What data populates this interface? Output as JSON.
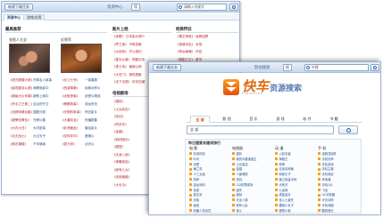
{
  "back_window": {
    "dropdown": "新建下载任务",
    "title": "资源中心",
    "search_placeholder": "请输入关键字",
    "search_button": "搜",
    "tabs": [
      "资源中心",
      "游戏/应用"
    ],
    "sections": {
      "hot_movies": "最具推荐",
      "new_releases": "新片上档",
      "classics": "经典怀旧"
    },
    "movie_one": "张智人大全",
    "movie_two": "近视军",
    "list_left": [
      "《阳光照耀大家》",
      "《影视部战斗团》",
      "《超级大片来袭》",
      "《杀手之王第二》",
      "《战狼特辑合集》",
      "《超警告警告》",
      "《大内小白》",
      "《功夫战士》",
      "《鲜花满楼》"
    ],
    "list_left2": [
      "开原名人故事",
      "我看电影中",
      "新鲜上映中",
      "百合的守卫",
      "国剧分类",
      "光荣片集",
      "大内密探",
      "大汉天子",
      "千年情缘"
    ],
    "list_mid": [
      "《长江七号》",
      "《西游降魔》",
      "《太极侠客》",
      "《警察故事》",
      "《光阴的故事》",
      "《大唐双龙》",
      "《卧虎藏龙》",
      "《花样年华》",
      "《霍元甲》"
    ],
    "list_mid2": [
      "一部喜剧",
      "经典动作片",
      "武侠片精选",
      "成龙系列",
      "怀旧影片",
      "热播剧集",
      "最佳影片",
      "爱情片",
      "功夫片"
    ],
    "new_list": [
      "《赤壁》 日本影片简介",
      "《梦之旅》 不再发散",
      "《大侦探》 开心相约",
      "《星光大道》 明星访谈",
      "《勇士传》 最新公映",
      "《大宅门》 精彩剧集",
      "《天下无贼》 好评如潮"
    ],
    "classic_list": [
      "《霸王别姬》 经典回顾",
      "《英雄本色》 永恒",
      "《倩女幽魂》 怀旧",
      "《喜剧之王》 星爷",
      "《射雕英雄传》 重温",
      "《西游记》 童年回忆",
      "《水浒传》 名著"
    ],
    "subsection": "电视剧场",
    "tv_list": [
      "《潜伏》",
      "《士兵突击》",
      "《亮剑》",
      "《闯关东》",
      "《金婚》",
      "《我的团长》",
      "《蜗居》",
      "《天龙八部》",
      "《神雕侠侣》",
      "《家有儿女》",
      "《还珠格格》",
      "《大长今》"
    ]
  },
  "front_window": {
    "dropdown": "新建下载任务",
    "title": "影视搜索",
    "search_value": "外搜",
    "search_button": "搜",
    "logo_text": "快车",
    "logo_sub_text": "资源搜索",
    "logo_caption": "FlashGet",
    "tabs": [
      "全 部",
      "影 视",
      "音 乐",
      "游 戏",
      "软 件",
      "书 籍"
    ],
    "main_search_value": "全 部",
    "panel_title": "昨日搜索关键词排行",
    "columns": [
      {
        "head": "电 影",
        "items": [
          "非诚勿扰",
          "叶问",
          "赤壁",
          "梅兰芳",
          "十三太保",
          "风声",
          "游龙戏凤",
          "色戒",
          "投名状",
          "无极",
          "画皮",
          "机器人总动员"
        ]
      },
      {
        "head": "电视剧",
        "items": [
          "潜伏",
          "我的青春谁做主",
          "士兵突击",
          "金婚",
          "十面埋伏",
          "亮剑",
          "CSI犯罪现场",
          "迷失",
          "越狱",
          "天龙八部",
          "家有儿女",
          "奋斗"
        ]
      },
      {
        "head": "动 漫",
        "items": [
          "火影忍者",
          "海贼王",
          "死神",
          "名侦探柯南",
          "网球王子",
          "钢之炼金术师",
          "犬夜叉",
          "七龙珠",
          "灌篮高手",
          "圣斗士星矢",
          "樱桃小丸子",
          "蜡笔小新"
        ]
      },
      {
        "head": "手 机",
        "items": [
          "诺基亚固件",
          "手机铃声",
          "手机游戏",
          "手机主题",
          "手机电影",
          "来电通",
          "手机QQ",
          "飞信",
          "UC浏览器",
          "天天动听",
          "手机地图",
          "酷狗音乐"
        ]
      }
    ]
  },
  "colors": {
    "accent_orange": "#e36b10",
    "link_red": "#b0252e",
    "link_blue": "#224e8c",
    "titlebar": "#c7d9ee"
  }
}
